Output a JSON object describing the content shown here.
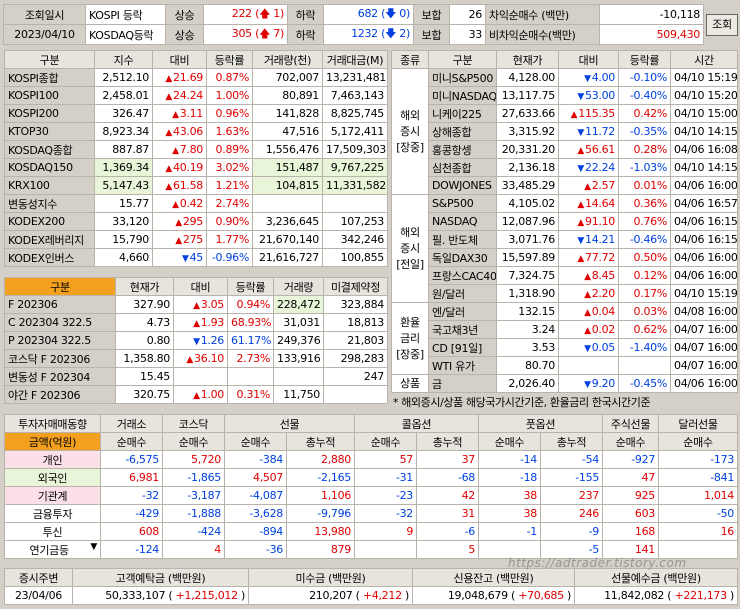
{
  "header": {
    "row1": {
      "label": "조회일시",
      "market": "KOSPI 등락",
      "up_label": "상승",
      "up": "222",
      "up_limit": "1",
      "down_label": "하락",
      "down": "682",
      "down_limit": "0",
      "flat_label": "보합",
      "flat": "26",
      "arb_label": "차익순매수 (백만)",
      "arb": "-10,118"
    },
    "row2": {
      "label": "2023/04/10",
      "market": "KOSDAQ등락",
      "up_label": "상승",
      "up": "305",
      "up_limit": "7",
      "down_label": "하락",
      "down": "1232",
      "down_limit": "2",
      "flat_label": "보합",
      "flat": "33",
      "arb_label": "비차익순매수(백만)",
      "arb": "509,430"
    },
    "search_button": "조회"
  },
  "index_table": {
    "headers": [
      "구분",
      "지수",
      "대비",
      "등락률",
      "거래량(천)",
      "거래대금(M)"
    ],
    "rows": [
      {
        "name": "KOSPI종합",
        "value": "2,512.10",
        "dir": "up",
        "chg": "21.69",
        "rate": "0.87%",
        "vol": "702,007",
        "amt": "13,231,481"
      },
      {
        "name": "KOSPI100",
        "value": "2,458.01",
        "dir": "up",
        "chg": "24.24",
        "rate": "1.00%",
        "vol": "80,891",
        "amt": "7,463,143"
      },
      {
        "name": "KOSPI200",
        "value": "326.47",
        "dir": "up",
        "chg": "3.11",
        "rate": "0.96%",
        "vol": "141,828",
        "amt": "8,825,745"
      },
      {
        "name": "KTOP30",
        "value": "8,923.34",
        "dir": "up",
        "chg": "43.06",
        "rate": "1.63%",
        "vol": "47,516",
        "amt": "5,172,411"
      },
      {
        "name": "KOSDAQ종합",
        "value": "887.87",
        "dir": "up",
        "chg": "7.80",
        "rate": "0.89%",
        "vol": "1,556,476",
        "amt": "17,509,303"
      },
      {
        "name": "KOSDAQ150",
        "value": "1,369.34",
        "dir": "up",
        "chg": "40.19",
        "rate": "3.02%",
        "vol": "151,487",
        "amt": "9,767,225"
      },
      {
        "name": "KRX100",
        "value": "5,147.43",
        "dir": "up",
        "chg": "61.58",
        "rate": "1.21%",
        "vol": "104,815",
        "amt": "11,331,582"
      },
      {
        "name": "변동성지수",
        "value": "15.77",
        "dir": "up",
        "chg": "0.42",
        "rate": "2.74%",
        "vol": "",
        "amt": ""
      },
      {
        "name": "KODEX200",
        "value": "33,120",
        "dir": "up",
        "chg": "295",
        "rate": "0.90%",
        "vol": "3,236,645",
        "amt": "107,253"
      },
      {
        "name": "KODEX레버리지",
        "value": "15,790",
        "dir": "up",
        "chg": "275",
        "rate": "1.77%",
        "vol": "21,670,140",
        "amt": "342,246"
      },
      {
        "name": "KODEX인버스",
        "value": "4,660",
        "dir": "dn",
        "chg": "45",
        "rate": "-0.96%",
        "vol": "21,616,727",
        "amt": "100,855"
      }
    ]
  },
  "futures_table": {
    "headers": [
      "구분",
      "현재가",
      "대비",
      "등락률",
      "거래량",
      "미결제약정"
    ],
    "rows": [
      {
        "name": "F 202306",
        "value": "327.90",
        "dir": "up",
        "chg": "3.05",
        "rate": "0.94%",
        "vol": "228,472",
        "oi": "323,884"
      },
      {
        "name": "C 202304 322.5",
        "value": "4.73",
        "dir": "up",
        "chg": "1.93",
        "rate": "68.93%",
        "vol": "31,031",
        "oi": "18,813"
      },
      {
        "name": "P 202304 322.5",
        "value": "0.80",
        "dir": "dn",
        "chg": "1.26",
        "rate": "61.17%",
        "vol": "249,376",
        "oi": "21,803"
      },
      {
        "name": "코스닥 F 202306",
        "value": "1,358.80",
        "dir": "up",
        "chg": "36.10",
        "rate": "2.73%",
        "vol": "133,916",
        "oi": "298,283"
      },
      {
        "name": "변동성 F 202304",
        "value": "15.45",
        "dir": "",
        "chg": "",
        "rate": "",
        "vol": "",
        "oi": "247"
      },
      {
        "name": "야간 F 202306",
        "value": "320.75",
        "dir": "up",
        "chg": "1.00",
        "rate": "0.31%",
        "vol": "11,750",
        "oi": ""
      }
    ]
  },
  "global_table": {
    "headers": [
      "종류",
      "구분",
      "현재가",
      "대비",
      "등락률",
      "시간"
    ],
    "groups": [
      {
        "label": [
          "해외",
          "증시",
          "[장중]"
        ],
        "span": 7
      },
      {
        "label": [
          "해외",
          "증시",
          "[전일]"
        ],
        "span": 6
      },
      {
        "label": [
          "환율",
          "금리",
          "[장중]"
        ],
        "span": 4
      },
      {
        "label": [
          "상품"
        ],
        "span": 2
      }
    ],
    "rows": [
      {
        "name": "미니S&P500",
        "value": "4,128.00",
        "dir": "dn",
        "chg": "4.00",
        "rate": "-0.10%",
        "time": "04/10 15:19"
      },
      {
        "name": "미니NASDAQ",
        "value": "13,117.75",
        "dir": "dn",
        "chg": "53.00",
        "rate": "-0.40%",
        "time": "04/10 15:20"
      },
      {
        "name": "니케이225",
        "value": "27,633.66",
        "dir": "up",
        "chg": "115.35",
        "rate": "0.42%",
        "time": "04/10 15:00"
      },
      {
        "name": "상해종합",
        "value": "3,315.92",
        "dir": "dn",
        "chg": "11.72",
        "rate": "-0.35%",
        "time": "04/10 14:15"
      },
      {
        "name": "홍콩항셍",
        "value": "20,331.20",
        "dir": "up",
        "chg": "56.61",
        "rate": "0.28%",
        "time": "04/06 16:08"
      },
      {
        "name": "심천종합",
        "value": "2,136.18",
        "dir": "dn",
        "chg": "22.24",
        "rate": "-1.03%",
        "time": "04/10 14:15"
      },
      {
        "name": "DOWJONES",
        "value": "33,485.29",
        "dir": "up",
        "chg": "2.57",
        "rate": "0.01%",
        "time": "04/06 16:00"
      },
      {
        "name": "S&P500",
        "value": "4,105.02",
        "dir": "up",
        "chg": "14.64",
        "rate": "0.36%",
        "time": "04/06 16:57"
      },
      {
        "name": "NASDAQ",
        "value": "12,087.96",
        "dir": "up",
        "chg": "91.10",
        "rate": "0.76%",
        "time": "04/06 16:15"
      },
      {
        "name": "필. 반도체",
        "value": "3,071.76",
        "dir": "dn",
        "chg": "14.21",
        "rate": "-0.46%",
        "time": "04/06 16:15"
      },
      {
        "name": "독일DAX30",
        "value": "15,597.89",
        "dir": "up",
        "chg": "77.72",
        "rate": "0.50%",
        "time": "04/06 16:00"
      },
      {
        "name": "프랑스CAC40",
        "value": "7,324.75",
        "dir": "up",
        "chg": "8.45",
        "rate": "0.12%",
        "time": "04/06 16:00"
      },
      {
        "name": "원/달러",
        "value": "1,318.90",
        "dir": "up",
        "chg": "2.20",
        "rate": "0.17%",
        "time": "04/10 15:19"
      },
      {
        "name": "엔/달러",
        "value": "132.15",
        "dir": "up",
        "chg": "0.04",
        "rate": "0.03%",
        "time": "04/08 16:00"
      },
      {
        "name": "국고채3년",
        "value": "3.24",
        "dir": "up",
        "chg": "0.02",
        "rate": "0.62%",
        "time": "04/07 16:00"
      },
      {
        "name": "CD [91일]",
        "value": "3.53",
        "dir": "dn",
        "chg": "0.05",
        "rate": "-1.40%",
        "time": "04/07 16:00"
      },
      {
        "name": "WTI 유가",
        "value": "80.70",
        "dir": "",
        "chg": "",
        "rate": "",
        "time": "04/07 16:00"
      },
      {
        "name": "금",
        "value": "2,026.40",
        "dir": "dn",
        "chg": "9.20",
        "rate": "-0.45%",
        "time": "04/06 16:00"
      }
    ],
    "note": "* 해외증시/상품 해당국가시간기준, 환율금리 한국시간기준"
  },
  "investor_table": {
    "title": "투자자매매동향",
    "top_headers": [
      "거래소",
      "코스닥",
      "선물",
      "콜옵션",
      "풋옵션",
      "주식선물",
      "달러선물"
    ],
    "unit_label": "금액(억원)",
    "sub_headers": [
      "순매수",
      "순매수",
      "순매수",
      "총누적",
      "순매수",
      "총누적",
      "순매수",
      "총누적",
      "순매수",
      "순매수"
    ],
    "rows": [
      {
        "name": "개인",
        "cls": "p",
        "vals": [
          "-6,575",
          "5,720",
          "-384",
          "2,880",
          "57",
          "37",
          "-14",
          "-54",
          "-927",
          "-173"
        ]
      },
      {
        "name": "외국인",
        "cls": "g",
        "vals": [
          "6,981",
          "-1,865",
          "4,507",
          "-2,165",
          "-31",
          "-68",
          "-18",
          "-155",
          "47",
          "-841"
        ]
      },
      {
        "name": "기관계",
        "cls": "p",
        "vals": [
          "-32",
          "-3,187",
          "-4,087",
          "1,106",
          "-23",
          "42",
          "38",
          "237",
          "925",
          "1,014"
        ]
      },
      {
        "name": "금융투자",
        "cls": "w",
        "vals": [
          "-429",
          "-1,888",
          "-3,628",
          "-9,796",
          "-32",
          "31",
          "38",
          "246",
          "603",
          "-50"
        ]
      },
      {
        "name": "투신",
        "cls": "w",
        "vals": [
          "608",
          "-424",
          "-894",
          "13,980",
          "9",
          "-6",
          "-1",
          "-9",
          "168",
          "16"
        ]
      },
      {
        "name": "연기금등",
        "cls": "w",
        "vals": [
          "-124",
          "4",
          "-36",
          "879",
          "",
          "5",
          "",
          "-5",
          "141",
          ""
        ]
      }
    ]
  },
  "footer": {
    "headers": [
      "증시주변",
      "고객예탁금 (백만원)",
      "미수금 (백만원)",
      "신용잔고 (백만원)",
      "선물예수금 (백만원)"
    ],
    "date": "23/04/06",
    "deposit": "50,333,107",
    "deposit_chg": "+1,215,012",
    "unpaid": "210,207",
    "unpaid_chg": "+4,212",
    "credit": "19,048,679",
    "credit_chg": "+70,685",
    "fut": "11,842,082",
    "fut_chg": "+221,173"
  },
  "watermark": "https://adtrader.tistory.com"
}
